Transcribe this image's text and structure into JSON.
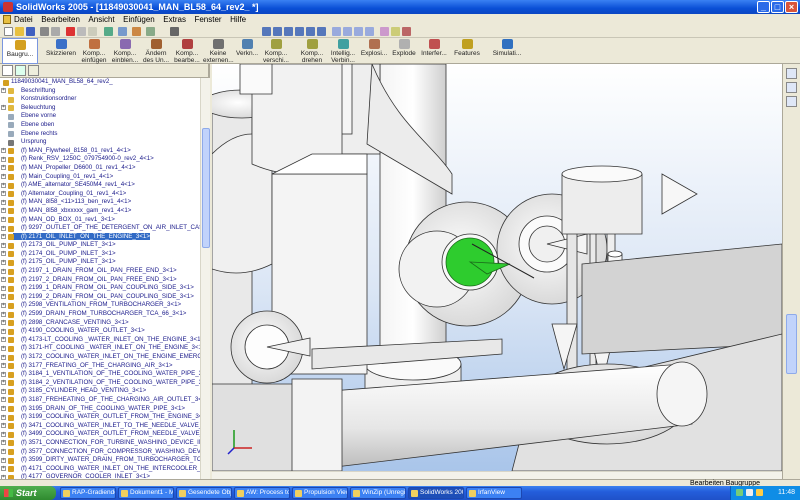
{
  "window": {
    "title": "SolidWorks 2005 - [11849030041_MAN_BL58_64_rev2_ *]"
  },
  "menu": [
    "Datei",
    "Bearbeiten",
    "Ansicht",
    "Einfügen",
    "Extras",
    "Fenster",
    "Hilfe"
  ],
  "command_manager": [
    {
      "label": "Baugru...",
      "active": true
    },
    {
      "label": "Skizzieren",
      "active": false
    },
    {
      "label": "Komp... einfügen",
      "active": false
    },
    {
      "label": "Komp... einblen...",
      "active": false
    },
    {
      "label": "Ändern des Un...",
      "active": false
    },
    {
      "label": "Komp... bearbe...",
      "active": false
    },
    {
      "label": "Keine externen...",
      "active": false
    },
    {
      "label": "Verkn...",
      "active": false
    },
    {
      "label": "Komp... verschi...",
      "active": false
    },
    {
      "label": "Komp... drehen",
      "active": false
    },
    {
      "label": "Intellig... Verbin...",
      "active": false
    },
    {
      "label": "Explosi...",
      "active": false
    },
    {
      "label": "Explode",
      "active": false
    },
    {
      "label": "Interfer...",
      "active": false
    },
    {
      "label": "Features",
      "active": false
    },
    {
      "label": "Simulati...",
      "active": false
    }
  ],
  "tree": {
    "root": "11849030041_MAN_BL58_64_rev2_",
    "items": [
      {
        "label": "Beschriftung",
        "level": 1
      },
      {
        "label": "Konstruktionsordner",
        "level": 1
      },
      {
        "label": "Beleuchtung",
        "level": 1
      },
      {
        "label": "Ebene vorne",
        "level": 1
      },
      {
        "label": "Ebene oben",
        "level": 1
      },
      {
        "label": "Ebene rechts",
        "level": 1
      },
      {
        "label": "Ursprung",
        "level": 1
      },
      {
        "label": "(f) MAN_Flywheel_8158_01_rev1_4<1>",
        "level": 1
      },
      {
        "label": "(f) Renk_RSV_1250C_079754900-0_rev2_4<1>",
        "level": 1
      },
      {
        "label": "(f) MAN_Propeller_D6600_01_rev1_4<1>",
        "level": 1
      },
      {
        "label": "(f) Main_Coupling_01_rev1_4<1>",
        "level": 1
      },
      {
        "label": "(f) AME_alternator_SE450M4_rev1_4<1>",
        "level": 1
      },
      {
        "label": "(f) Alternator_Coupling_01_rev1_4<1>",
        "level": 1
      },
      {
        "label": "(f) MAN_8l58_<11>113_ben_rev1_4<1>",
        "level": 1
      },
      {
        "label": "(f) MAN_8l58_xbxxxxx_gam_rev1_4<1>",
        "level": 1
      },
      {
        "label": "(f) MAN_OD_BOX_01_rev1_3<1>",
        "level": 1
      },
      {
        "label": "(f) 9297_OUTLET_OF_THE_DETERGENT_ON_AIR_INLET_CASING_2<",
        "level": 1
      },
      {
        "label": "(f) 2171_OIL_INLET_ON_THE_ENGINE_3<1>",
        "level": 1,
        "selected": true
      },
      {
        "label": "(f) 2173_OIL_PUMP_INLET_3<1>",
        "level": 1
      },
      {
        "label": "(f) 2174_OIL_PUMP_INLET_3<1>",
        "level": 1
      },
      {
        "label": "(f) 2175_OIL_PUMP_INLET_3<1>",
        "level": 1
      },
      {
        "label": "(f) 2197_1_DRAIN_FROM_OIL_PAN_FREE_END_3<1>",
        "level": 1
      },
      {
        "label": "(f) 2197_2_DRAIN_FROM_OIL_PAN_FREE_END_3<1>",
        "level": 1
      },
      {
        "label": "(f) 2199_1_DRAIN_FROM_OIL_PAN_COUPLING_SIDE_3<1>",
        "level": 1
      },
      {
        "label": "(f) 2199_2_DRAIN_FROM_OIL_PAN_COUPLING_SIDE_3<1>",
        "level": 1
      },
      {
        "label": "(f) 2598_VENTILATION_FROM_TURBOCHARGER_3<1>",
        "level": 1
      },
      {
        "label": "(f) 2599_DRAIN_FROM_TURBOCHARGER_TCA_66_3<1>",
        "level": 1
      },
      {
        "label": "(f) 2898_CRANCASE_VENTING_3<1>",
        "level": 1
      },
      {
        "label": "(f) 4190_COOLING_WATER_OUTLET_3<1>",
        "level": 1
      },
      {
        "label": "(f) 4173-LT_COOLING _WATER_INLET_ON_THE_ENGINE_3<1>",
        "level": 1
      },
      {
        "label": "(f) 3171-HT_COOLING _WATER_INLET_ON_THE_ENGINE_3<1>",
        "level": 1
      },
      {
        "label": "(f) 3172_COOLING_WATER_INLET_ON_THE_ENGINE_EMERGENCY_",
        "level": 1
      },
      {
        "label": "(f) 3177_FREATING_OF_THE_CHARGING_AIR_3<1>",
        "level": 1
      },
      {
        "label": "(f) 3184_1_VENTILATION_OF_THE_COOLING_WATER_PIPE_3<1>",
        "level": 1
      },
      {
        "label": "(f) 3184_2_VENTILATION_OF_THE_COOLING_WATER_PIPE_3<1>",
        "level": 1
      },
      {
        "label": "(f) 3185_CYLINDER_HEAD_VENTING_3<1>",
        "level": 1
      },
      {
        "label": "(f) 3187_FREHEATING_OF_THE_CHARGING_AIR_OUTLET_3<1>",
        "level": 1
      },
      {
        "label": "(f) 3195_DRAIN_OF_THE_COOLING_WATER_PIPE_3<1>",
        "level": 1
      },
      {
        "label": "(f) 3199_COOLING_WATER_OUTLET_FROM_THE_ENGINE_3<1>",
        "level": 1
      },
      {
        "label": "(f) 3471_COOLING_WATER_INLET_TO_THE_NEEDLE_VALVE_3<1>",
        "level": 1
      },
      {
        "label": "(f) 3499_COOLING_WATER_OUTLET_FROM_NEEDLE_VALVE_3<1>",
        "level": 1
      },
      {
        "label": "(f) 3571_CONNECTION_FOR_TURBINE_WASHING_DEVICE_INLET_",
        "level": 1
      },
      {
        "label": "(f) 3577_CONNECTION_FOR_COMPRESSOR_WASHING_DEVICE_INLE",
        "level": 1
      },
      {
        "label": "(f) 3599_DIRTY_WATER_DRAIN_FROM_TURBOCHARGER_TCA_66_3",
        "level": 1
      },
      {
        "label": "(f) 4171_COOLING_WATER_INLET_ON_THE_INTERCOOLER_STEP_",
        "level": 1
      },
      {
        "label": "(f) 4177_GOVERNOR_COOLER_INLET_3<1>",
        "level": 1
      }
    ]
  },
  "status": {
    "mode": "Bearbeiten Baugruppe"
  },
  "taskbar": {
    "start": "Start",
    "tasks": [
      {
        "label": "RAP-Gradiendeb..."
      },
      {
        "label": "Dokument1 - Mi..."
      },
      {
        "label": "Gesendete Obje..."
      },
      {
        "label": "AW: Process to ..."
      },
      {
        "label": "Propulsion Viewer"
      },
      {
        "label": "WinZip (Unregis..."
      },
      {
        "label": "SolidWorks 200...",
        "active": true
      },
      {
        "label": "IrfanView"
      }
    ],
    "clock": "11:48"
  },
  "colors": {
    "selected_face": "#2ecc2e",
    "tree_selection": "#316ac5",
    "viewport_bottom": "#a9c5ea"
  }
}
